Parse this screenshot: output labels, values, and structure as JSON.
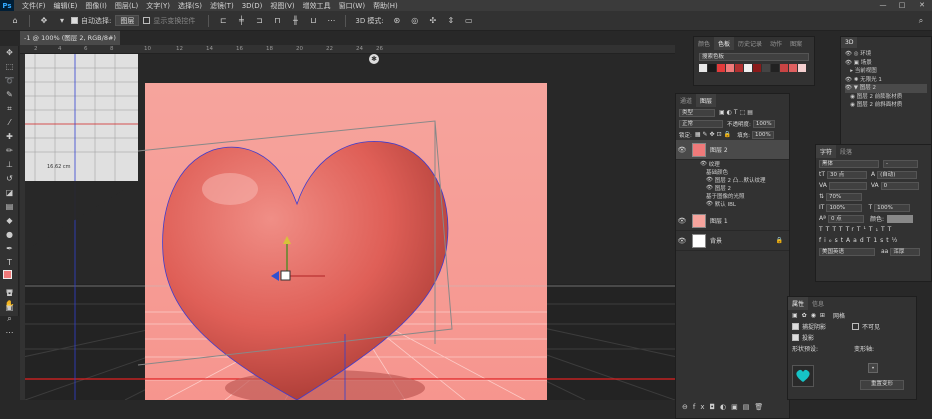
{
  "menubar": {
    "logo": "Ps",
    "items": [
      "文件(F)",
      "编辑(E)",
      "图像(I)",
      "图层(L)",
      "文字(Y)",
      "选择(S)",
      "滤镜(T)",
      "3D(D)",
      "视图(V)",
      "增效工具",
      "窗口(W)",
      "帮助(H)"
    ],
    "minimize": "—",
    "maximize": "□",
    "close": "✕"
  },
  "options": {
    "auto_select_label": "自动选择:",
    "auto_select_value": "图层",
    "show_transform": "显示变换控件",
    "mode_3d": "3D 模式:"
  },
  "doc": {
    "tab_title": "-1 @ 100% (图层 2, RGB/8#) *",
    "ruler_ticks": [
      "2",
      "4",
      "6",
      "8",
      "10",
      "12",
      "14",
      "16",
      "18",
      "20",
      "22",
      "24",
      "26"
    ],
    "dimension_label": "16.62 cm"
  },
  "swatch_panel": {
    "tabs": [
      "颜色",
      "色板",
      "历史记录",
      "动作",
      "图案"
    ],
    "search_placeholder": "搜索色板",
    "colors": [
      "#e8e8e8",
      "#1a1a1a",
      "#e33b3b",
      "#f07a7a",
      "#b03030",
      "#f0f0f0",
      "#8a1a1a",
      "#444444",
      "#222222",
      "#c84444",
      "#e06060",
      "#f5d0d0"
    ]
  },
  "layers_panel": {
    "tabs": [
      "通道",
      "图层"
    ],
    "filter_label": "类型",
    "blend_mode": "正常",
    "opacity_label": "不透明度:",
    "opacity_value": "100%",
    "lock_label": "锁定:",
    "fill_label": "填充:",
    "fill_value": "100%",
    "layers": [
      {
        "name": "图层 2",
        "children": [
          "纹理",
          "基础颜色",
          "图层 2 凸...默认纹理",
          "图层 2",
          "基于图像的光照",
          "默认 IBL"
        ]
      },
      {
        "name": "图层 1"
      },
      {
        "name": "背景"
      }
    ]
  },
  "panel_3d": {
    "tab": "3D",
    "items": [
      "环境",
      "场景",
      "当前视图",
      "无限光 1",
      "图层 2",
      "图层 2 前膨胀材质",
      "图层 2 前斜面材质"
    ]
  },
  "char_panel": {
    "tabs": [
      "字符",
      "段落"
    ],
    "font_family": "黑体",
    "font_style": "-",
    "size": "30 点",
    "leading": "(自动)",
    "kerning": "",
    "tracking": "0",
    "vscale": "100%",
    "hscale": "100%",
    "baseline": "0 点",
    "color_label": "颜色:",
    "fill_percent": "70%",
    "language": "美国英语",
    "aa": "浑厚",
    "ot_row": [
      "T",
      "T",
      "TT",
      "Tr",
      "T¹",
      "T₁",
      "T",
      "T"
    ],
    "fi_row": [
      "fi",
      "ℴ",
      "st",
      "A",
      "ad",
      "T",
      "1st",
      "½"
    ]
  },
  "props_panel": {
    "tabs": [
      "属性",
      "信息"
    ],
    "mesh_label": "网格",
    "catch_shadow": "捕捉阴影",
    "cast_shadow": "投影",
    "invisible": "不可见",
    "shape_preset": "形状预设:",
    "deform_axis": "变形轴:",
    "reset_deform": "重置变形"
  }
}
